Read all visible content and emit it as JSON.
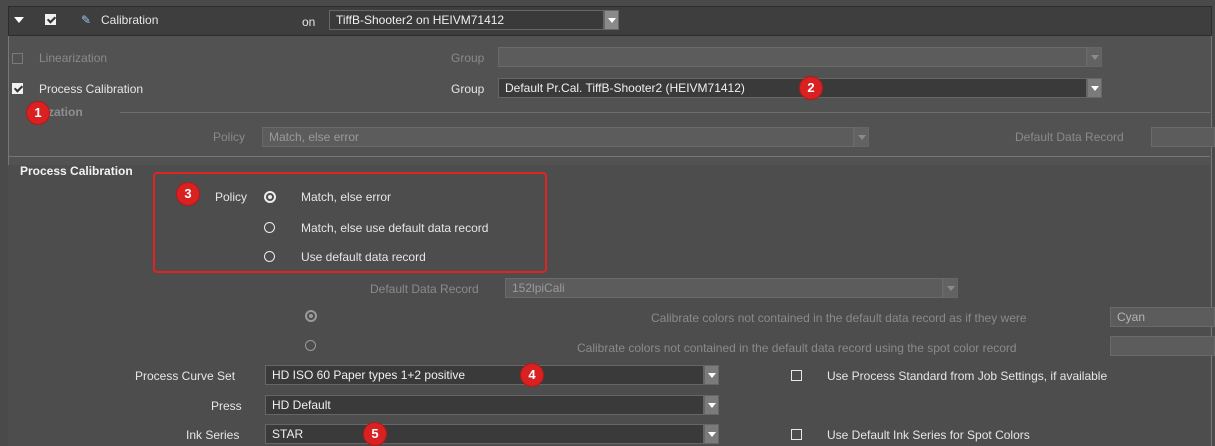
{
  "header": {
    "title": "Calibration",
    "on_label": "on",
    "target_value": "TiffB-Shooter2 on HEIVM71412"
  },
  "rows": {
    "linearization": {
      "label": "Linearization",
      "group_label": "Group",
      "group_value": ""
    },
    "process_calibration": {
      "label": "Process Calibration",
      "group_label": "Group",
      "group_value": "Default Pr.Cal. TiffB-Shooter2 (HEIVM71412)"
    }
  },
  "linearization_section": {
    "title": "rization",
    "policy_label": "Policy",
    "policy_value": "Match, else error",
    "default_record_label": "Default Data Record",
    "default_record_value": ""
  },
  "process_section": {
    "title": "Process Calibration",
    "policy_label": "Policy",
    "policy_options": [
      "Match, else error",
      "Match, else use default data record",
      "Use default data record"
    ],
    "default_record_label": "Default Data Record",
    "default_record_value": "152lpiCali",
    "calibrate_option_1": "Calibrate colors not contained in the default data record as if they were",
    "calibrate_option_1_value": "Cyan",
    "calibrate_option_2": "Calibrate colors not contained in the default data record using the spot color record",
    "calibrate_option_2_value": "",
    "curve_set_label": "Process Curve Set",
    "curve_set_value": "HD ISO 60 Paper types 1+2 positive",
    "press_label": "Press",
    "press_value": "HD Default",
    "ink_series_label": "Ink Series",
    "ink_series_value": "STAR",
    "use_process_standard": "Use Process Standard from Job Settings, if available",
    "use_default_ink": "Use Default Ink Series for Spot Colors"
  },
  "callouts": [
    "1",
    "2",
    "3",
    "4",
    "5"
  ],
  "colors": {
    "callout": "#d92121",
    "background": "#4a4a4a"
  }
}
